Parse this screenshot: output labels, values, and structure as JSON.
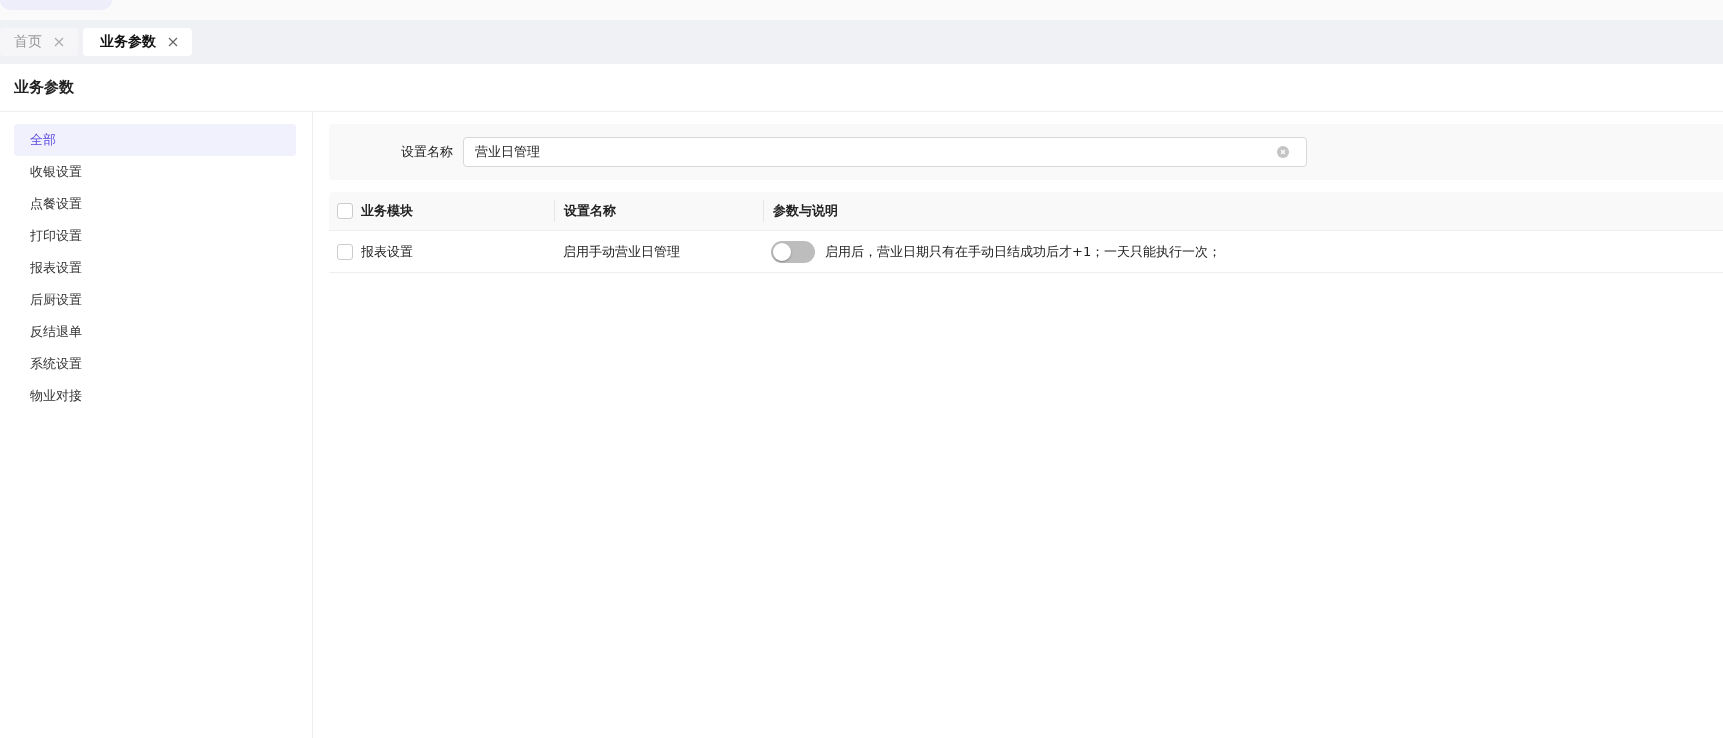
{
  "tabs": [
    {
      "label": "首页",
      "selected": false
    },
    {
      "label": "业务参数",
      "selected": true
    }
  ],
  "page_title": "业务参数",
  "sidebar": {
    "items": [
      {
        "label": "全部",
        "selected": true
      },
      {
        "label": "收银设置",
        "selected": false
      },
      {
        "label": "点餐设置",
        "selected": false
      },
      {
        "label": "打印设置",
        "selected": false
      },
      {
        "label": "报表设置",
        "selected": false
      },
      {
        "label": "后厨设置",
        "selected": false
      },
      {
        "label": "反结退单",
        "selected": false
      },
      {
        "label": "系统设置",
        "selected": false
      },
      {
        "label": "物业对接",
        "selected": false
      }
    ]
  },
  "filter": {
    "label": "设置名称",
    "value": "营业日管理"
  },
  "table": {
    "select_all_checked": false,
    "columns": [
      "业务模块",
      "设置名称",
      "参数与说明"
    ],
    "rows": [
      {
        "checked": false,
        "module": "报表设置",
        "name": "启用手动营业日管理",
        "on": false,
        "description": "启用后，营业日期只有在手动日结成功后才+1；一天只能执行一次；"
      }
    ]
  }
}
